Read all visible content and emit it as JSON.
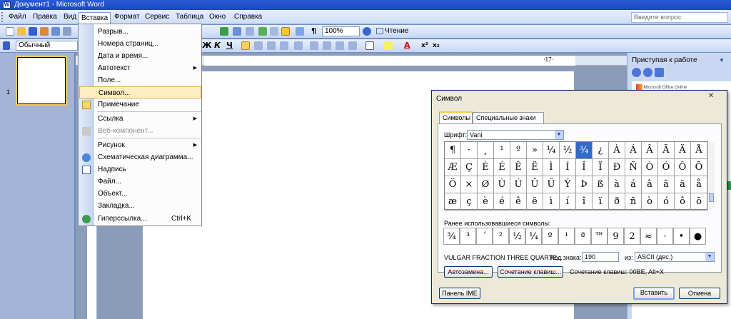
{
  "window": {
    "title": "Документ1 - Microsoft Word"
  },
  "menubar": {
    "items": [
      "Файл",
      "Правка",
      "Вид",
      "Вставка",
      "Формат",
      "Сервис",
      "Таблица",
      "Окно",
      "Справка"
    ],
    "help_placeholder": "Введите вопрос"
  },
  "toolbar": {
    "zoom": "100%",
    "reading_label": "Чтение",
    "style_value": "Обычный"
  },
  "ruler": {
    "mark": "·17·"
  },
  "thumbnails": {
    "page_number": "1"
  },
  "taskpane": {
    "title": "Приступая к работе",
    "logo_text": "Microsoft Office Online"
  },
  "insert_menu": {
    "items": [
      {
        "label": "Разрыв...",
        "icon": "none"
      },
      {
        "label": "Номера страниц...",
        "icon": "none"
      },
      {
        "label": "Дата и время...",
        "icon": "none"
      },
      {
        "label": "Автотекст",
        "icon": "none",
        "submenu": true
      },
      {
        "label": "Поле...",
        "icon": "none"
      },
      {
        "label": "Символ...",
        "icon": "none",
        "highlighted": true
      },
      {
        "label": "Примечание",
        "icon": "comment-icon"
      },
      {
        "label": "Ссылка",
        "icon": "none",
        "submenu": true
      },
      {
        "label": "Веб-компонент...",
        "icon": "web-component-icon",
        "disabled": true
      },
      {
        "label": "Рисунок",
        "icon": "none",
        "submenu": true
      },
      {
        "label": "Схематическая диаграмма...",
        "icon": "diagram-icon"
      },
      {
        "label": "Надпись",
        "icon": "textbox-icon"
      },
      {
        "label": "Файл...",
        "icon": "none"
      },
      {
        "label": "Объект...",
        "icon": "none"
      },
      {
        "label": "Закладка...",
        "icon": "none"
      },
      {
        "label": "Гиперссылка...",
        "icon": "hyperlink-icon",
        "shortcut": "Ctrl+K"
      }
    ]
  },
  "symbol_dialog": {
    "title": "Символ",
    "tabs": [
      "Символы",
      "Специальные знаки"
    ],
    "font_label": "Шрифт:",
    "font_value": "Vani",
    "grid": [
      [
        "¶",
        "·",
        "¸",
        "¹",
        "º",
        "»",
        "¼",
        "½",
        "¾",
        "¿",
        "À",
        "Á",
        "Â",
        "Ã",
        "Ä",
        "Å"
      ],
      [
        "Æ",
        "Ç",
        "È",
        "É",
        "Ê",
        "Ë",
        "Ì",
        "Í",
        "Î",
        "Ï",
        "Ð",
        "Ñ",
        "Ò",
        "Ó",
        "Ô",
        "Õ"
      ],
      [
        "Ö",
        "×",
        "Ø",
        "Ù",
        "Ú",
        "Û",
        "Ü",
        "Ý",
        "Þ",
        "ß",
        "à",
        "á",
        "â",
        "ã",
        "ä",
        "å"
      ],
      [
        "æ",
        "ç",
        "è",
        "é",
        "ê",
        "ë",
        "ì",
        "í",
        "î",
        "ï",
        "ð",
        "ñ",
        "ò",
        "ó",
        "ô",
        "õ"
      ]
    ],
    "selected_char": "¾",
    "recent_label": "Ранее использовавшиеся символы:",
    "recent": [
      "¾",
      "³",
      "´",
      "²",
      "½",
      "¼",
      "º",
      "¹",
      "ª",
      "™",
      "9",
      "2",
      "≈",
      "·",
      "•",
      "●"
    ],
    "char_name": "VULGAR FRACTION THREE QUARTE...",
    "code_label": "Код знака:",
    "code_value": "190",
    "from_label": "из:",
    "from_value": "ASCII (дес.)",
    "autocorrect_button": "Автозамена...",
    "shortcut_button": "Сочетание клавиш...",
    "shortcut_text": "Сочетание клавиш: 00BE, Alt+X",
    "ime_button": "Панель IME",
    "insert_button": "Вставить",
    "cancel_button": "Отмена"
  }
}
